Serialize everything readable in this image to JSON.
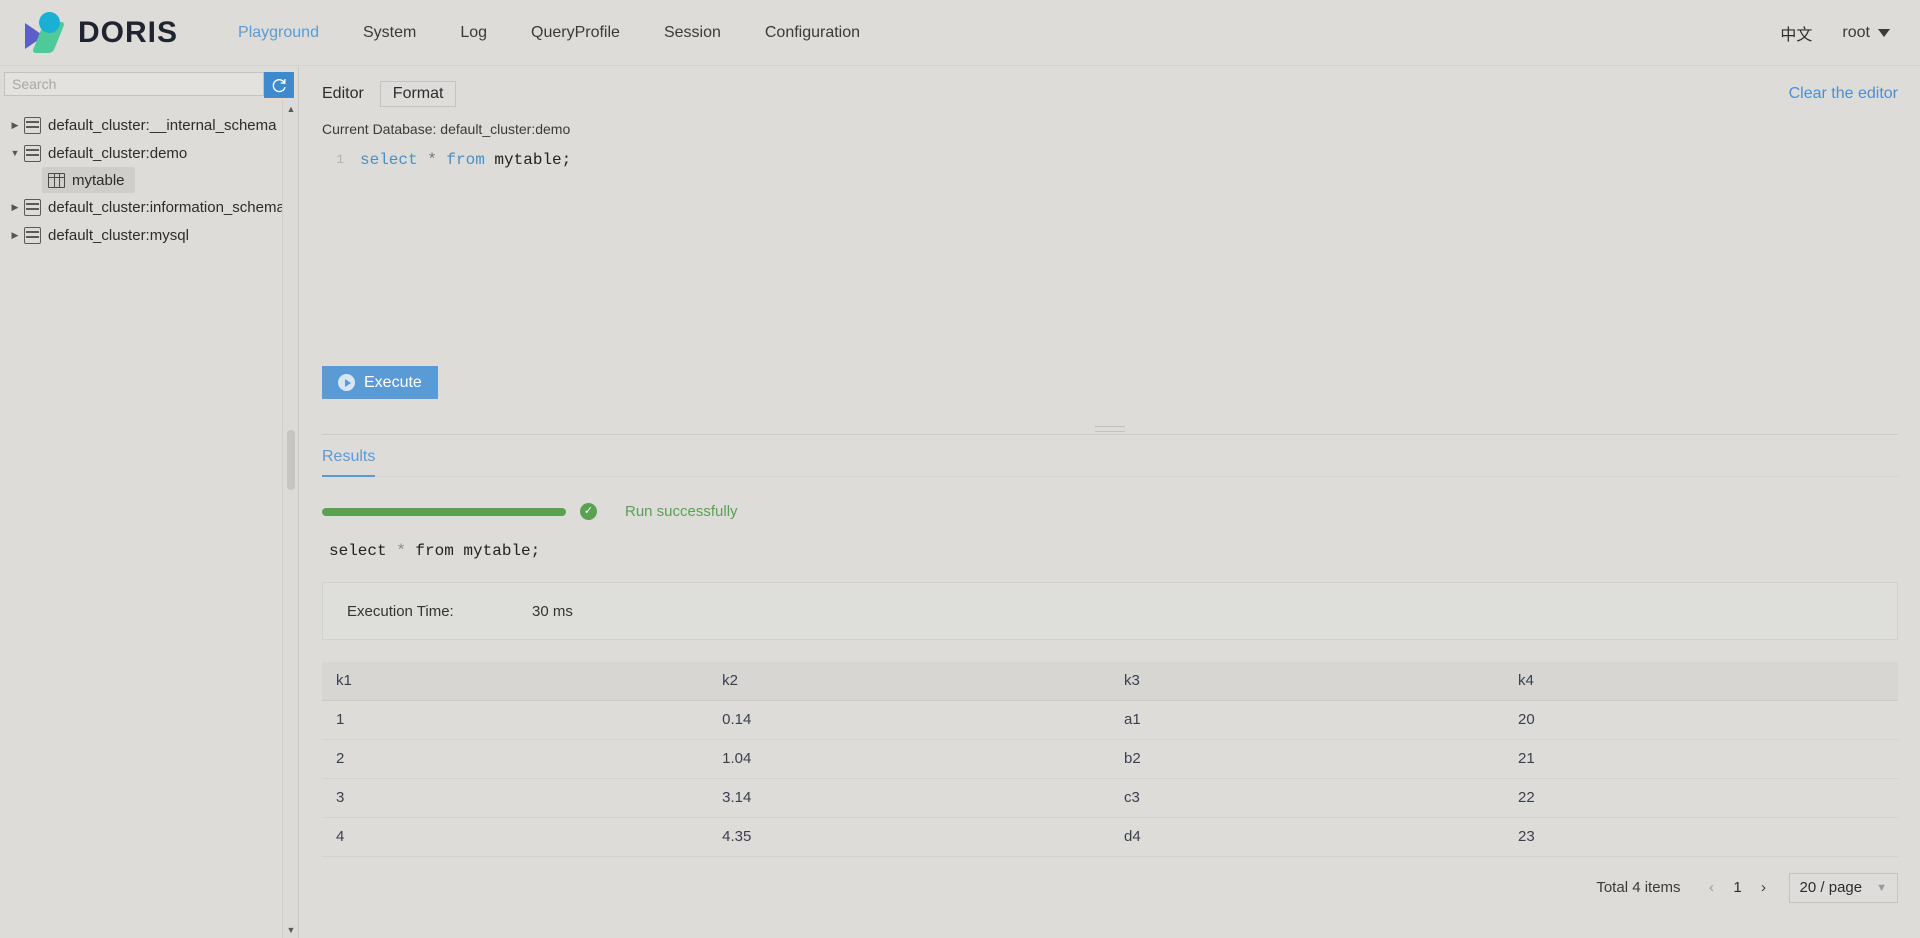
{
  "header": {
    "brand": "DORIS",
    "logo_icon": "doris-logo-icon",
    "nav": [
      {
        "label": "Playground",
        "active": true
      },
      {
        "label": "System",
        "active": false
      },
      {
        "label": "Log",
        "active": false
      },
      {
        "label": "QueryProfile",
        "active": false
      },
      {
        "label": "Session",
        "active": false
      },
      {
        "label": "Configuration",
        "active": false
      }
    ],
    "lang_switch": "中文",
    "user": "root",
    "caret_icon": "chevron-down-icon"
  },
  "sidebar": {
    "search_placeholder": "Search",
    "search_value": "",
    "refresh_icon": "refresh-icon",
    "tree": [
      {
        "label": "default_cluster:__internal_schema",
        "expanded": false,
        "icon": "database-icon"
      },
      {
        "label": "default_cluster:demo",
        "expanded": true,
        "icon": "database-icon",
        "children": [
          {
            "label": "mytable",
            "icon": "table-icon",
            "selected": true
          }
        ]
      },
      {
        "label": "default_cluster:information_schema",
        "expanded": false,
        "icon": "database-icon"
      },
      {
        "label": "default_cluster:mysql",
        "expanded": false,
        "icon": "database-icon"
      }
    ],
    "scroll_up_icon": "chevron-up-icon",
    "scroll_down_icon": "chevron-down-icon"
  },
  "editor": {
    "tab_label": "Editor",
    "format_label": "Format",
    "clear_label": "Clear the editor",
    "current_database": "Current Database: default_cluster:demo",
    "line_number": "1",
    "sql_keyword_select": "select",
    "sql_star": " * ",
    "sql_keyword_from": "from",
    "sql_table": " mytable;",
    "execute_label": "Execute",
    "play_icon": "play-icon"
  },
  "results": {
    "tab_label": "Results",
    "status_text": "Run successfully",
    "status_icon": "check-circle-icon",
    "progress_percent": 100,
    "echoed_sql_select": "select",
    "echoed_sql_star": " * ",
    "echoed_sql_from": "from",
    "echoed_sql_table": " mytable;",
    "execution_time_label": "Execution Time:",
    "execution_time_value": "30 ms",
    "columns": [
      "k1",
      "k2",
      "k3",
      "k4"
    ],
    "rows": [
      [
        "1",
        "0.14",
        "a1",
        "20"
      ],
      [
        "2",
        "1.04",
        "b2",
        "21"
      ],
      [
        "3",
        "3.14",
        "c3",
        "22"
      ],
      [
        "4",
        "4.35",
        "d4",
        "23"
      ]
    ],
    "pagination": {
      "total_label": "Total 4 items",
      "prev_icon": "chevron-left-icon",
      "next_icon": "chevron-right-icon",
      "current_page": "1",
      "page_size": "20 / page",
      "page_size_caret": "chevron-down-icon"
    }
  },
  "colors": {
    "accent_blue": "#5b9bd5",
    "success_green": "#5aa152",
    "background": "#dddcd9",
    "logo_blue": "#5b5fc7",
    "logo_cyan": "#1ab0d3",
    "logo_green": "#4ec99a"
  }
}
